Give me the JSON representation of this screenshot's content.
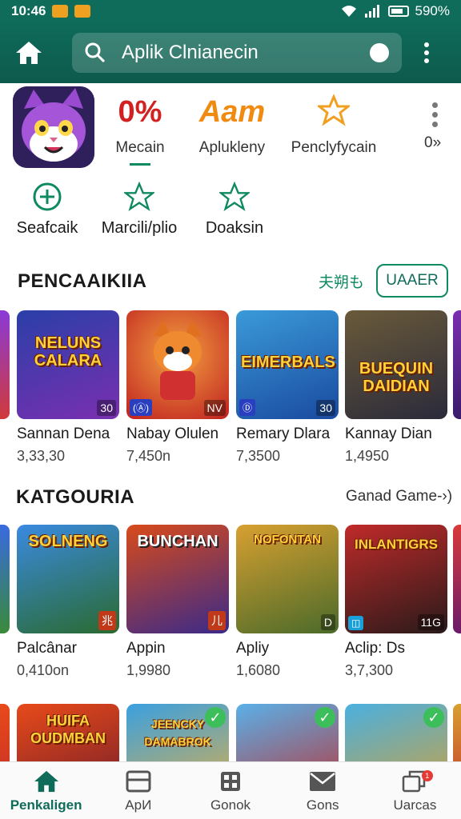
{
  "status": {
    "time": "10:46",
    "battery": "590%"
  },
  "search": {
    "query": "Aplik Clnianecin"
  },
  "app_header": {
    "stats": [
      {
        "value": "0%",
        "label": "Mecain",
        "color": "#d32020"
      },
      {
        "value": "Aam",
        "label": "Aplukleny",
        "color": "#f08a10"
      },
      {
        "value": "",
        "label": "Penclyfycain",
        "color": "#f0a020"
      }
    ],
    "more_label": "0»"
  },
  "actions": [
    {
      "label": "Seafcaik",
      "icon": "add-circle-icon"
    },
    {
      "label": "Marcili/plio",
      "icon": "star-outline-icon"
    },
    {
      "label": "Doaksin",
      "icon": "star-outline-icon"
    }
  ],
  "section1": {
    "title": "PENCAAIKIIA",
    "link": "夫朔も",
    "button": "UAAER",
    "cards": [
      {
        "art_text": "NELUNS CALARA",
        "title": "Sannan Dena",
        "sub": "3,33,30",
        "badge": "30",
        "badge_l": "",
        "colors": [
          "#2a3fa8",
          "#7a2fb0"
        ]
      },
      {
        "art_text": "",
        "title": "Nabay Olulen",
        "sub": "7,450n",
        "badge": "NV",
        "badge_l": "(Ⓐ)",
        "colors": [
          "#e8561a",
          "#c02020"
        ]
      },
      {
        "art_text": "EIMERBALS",
        "title": "Remary Dlara",
        "sub": "7,3500",
        "badge": "30",
        "badge_l": "Ⓓ",
        "colors": [
          "#3a9ad8",
          "#1a4aa0"
        ]
      },
      {
        "art_text": "BUEQUIN DAIDIAN",
        "title": "Kannay Dian",
        "sub": "1,4950",
        "badge": "",
        "badge_l": "",
        "colors": [
          "#5a4a3a",
          "#2a2a3a"
        ]
      }
    ]
  },
  "section2": {
    "title": "KATGOURIA",
    "more": "Ganad Game-›)",
    "cards": [
      {
        "art_text": "SOLNENG",
        "title": "Palcânar",
        "sub": "0,410on",
        "badge": "兆",
        "badge_l": "",
        "colors": [
          "#3a8ae0",
          "#2a6a30"
        ]
      },
      {
        "art_text": "BUNCHAN",
        "title": "Appin",
        "sub": "1,9980",
        "badge": "儿",
        "badge_l": "",
        "colors": [
          "#d84a1a",
          "#3a2a8a"
        ]
      },
      {
        "art_text": "NOFONTAN",
        "title": "Apliy",
        "sub": "1,6080",
        "badge": "D",
        "badge_l": "",
        "colors": [
          "#d8a030",
          "#4a6a2a"
        ]
      },
      {
        "art_text": "INLANTIGRS",
        "title": "Aclip: Ds",
        "sub": "3,7,300",
        "badge": "11G",
        "badge_l": "◫",
        "colors": [
          "#c02a2a",
          "#2a1a1a"
        ]
      }
    ]
  },
  "section3": {
    "cards": [
      {
        "art_text": "HUIFA OUDMBAN",
        "check": false,
        "colors": [
          "#e84a1a",
          "#6a1a2a"
        ]
      },
      {
        "art_text": "JEENCKY DAMABROK",
        "check": true,
        "colors": [
          "#3aa0e0",
          "#e8b040"
        ]
      },
      {
        "art_text": "",
        "check": true,
        "colors": [
          "#5ab0e8",
          "#c02a2a"
        ]
      },
      {
        "art_text": "",
        "check": true,
        "colors": [
          "#4ab0e0",
          "#d8a030"
        ]
      }
    ]
  },
  "bottom_nav": [
    {
      "label": "Penkaligen",
      "icon": "home-icon",
      "active": true
    },
    {
      "label": "ApИ",
      "icon": "apps-icon",
      "active": false
    },
    {
      "label": "Gonok",
      "icon": "grid-icon",
      "active": false
    },
    {
      "label": "Gons",
      "icon": "mail-icon",
      "active": false
    },
    {
      "label": "Uarcas",
      "icon": "updates-icon",
      "active": false,
      "badge": "1"
    }
  ]
}
